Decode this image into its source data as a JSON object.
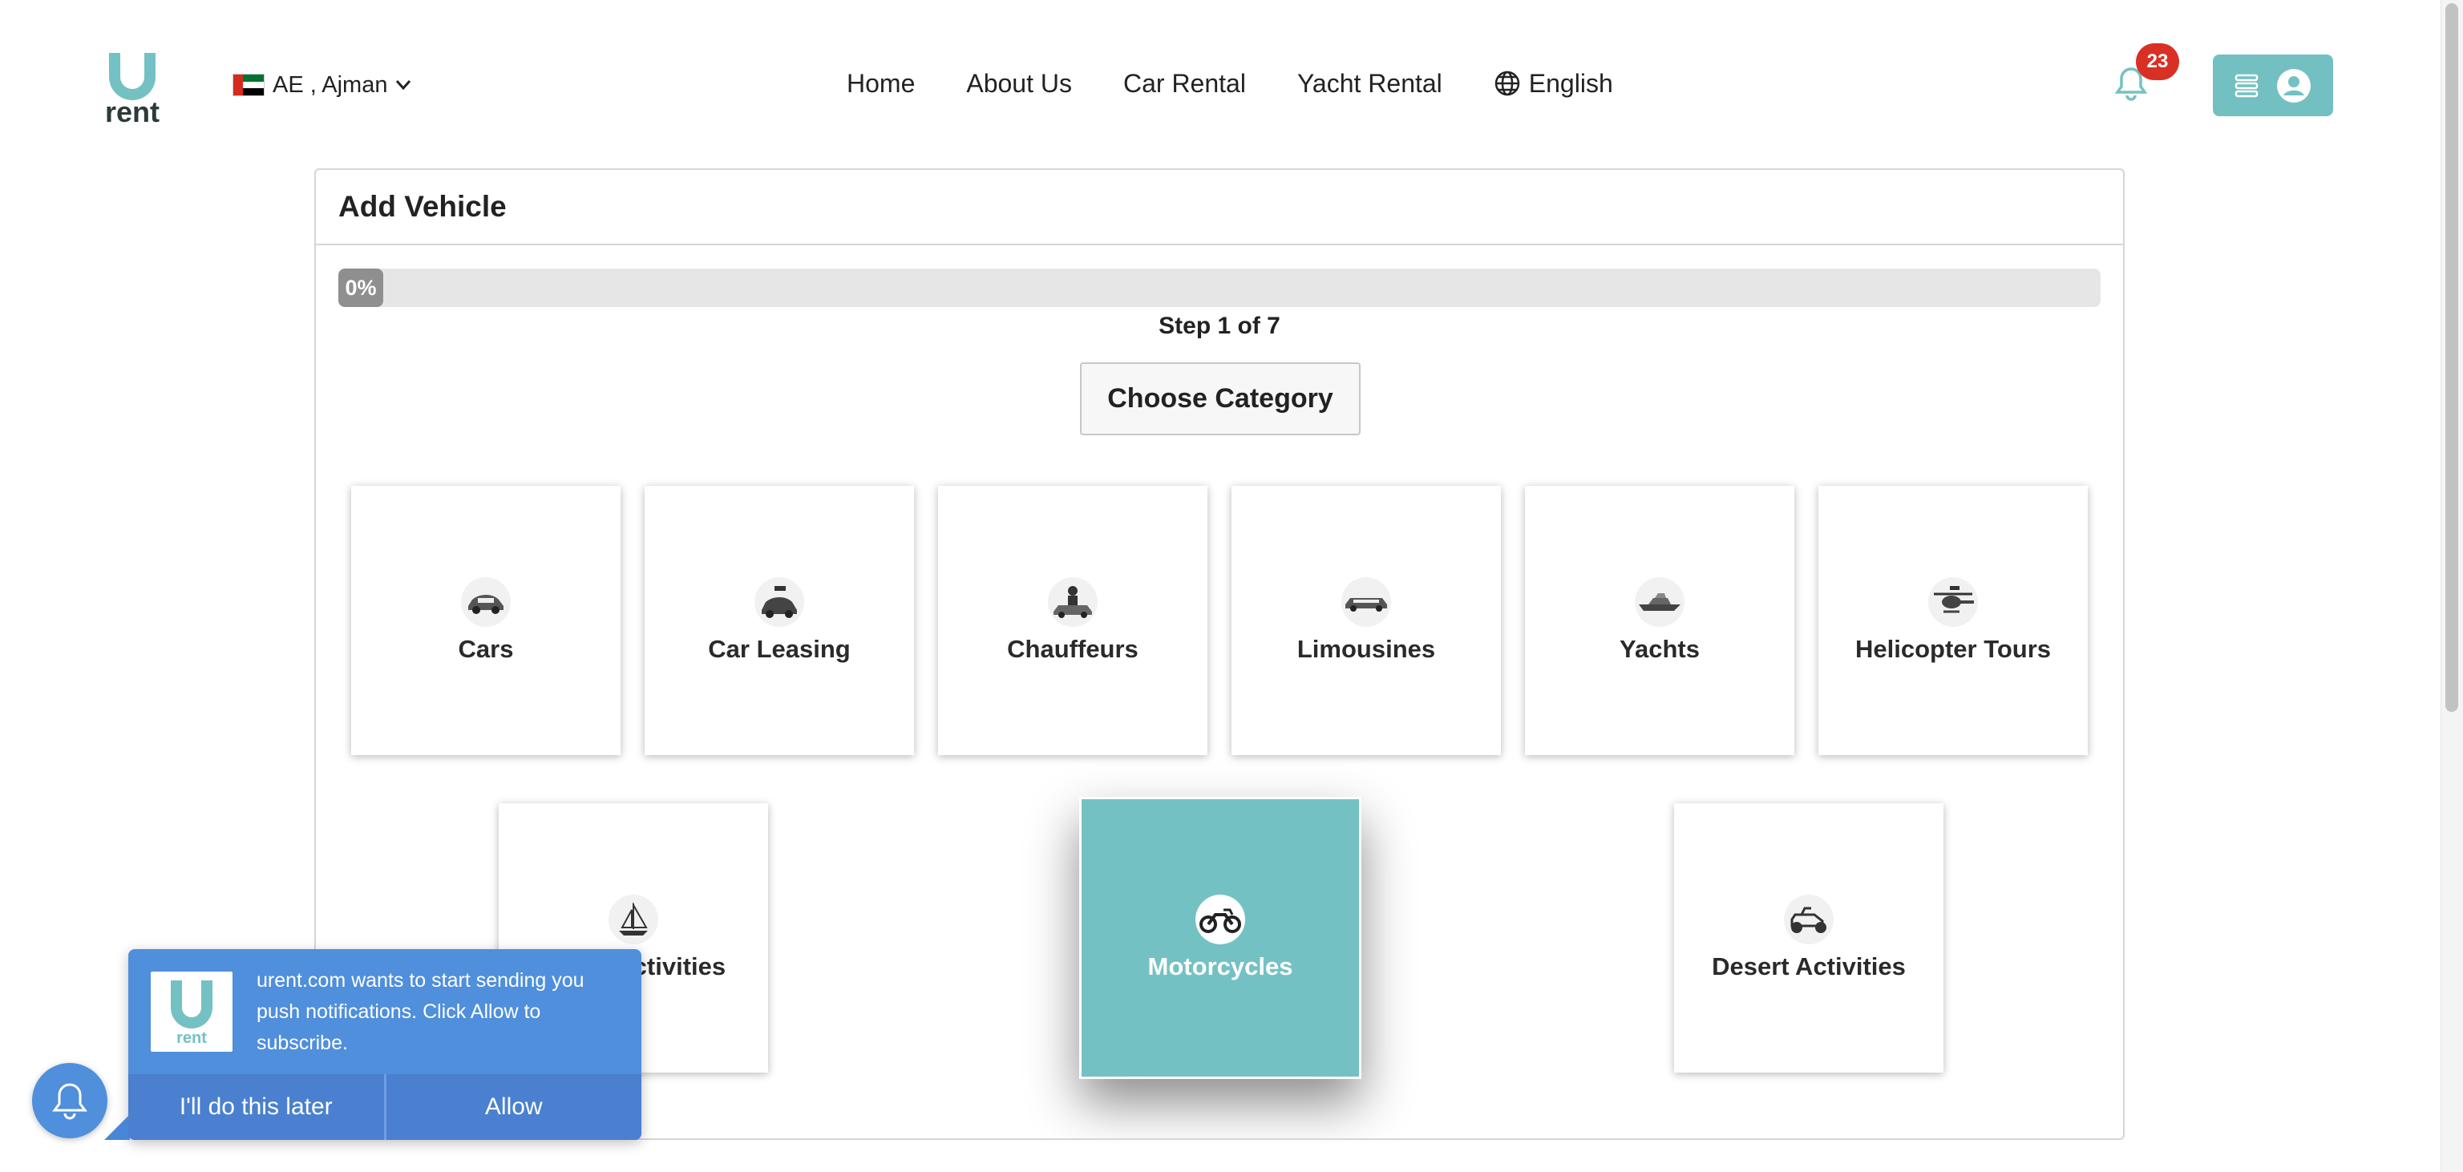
{
  "header": {
    "logo_text": "rent",
    "location": {
      "label": "AE , Ajman"
    },
    "nav": [
      {
        "label": "Home"
      },
      {
        "label": "About Us"
      },
      {
        "label": "Car Rental"
      },
      {
        "label": "Yacht Rental"
      }
    ],
    "language": {
      "label": "English"
    },
    "notifications": {
      "count": "23"
    }
  },
  "card": {
    "title": "Add Vehicle",
    "progress": {
      "label": "0%",
      "percent": 0
    },
    "step_text": "Step 1 of 7",
    "choose_button": "Choose Category",
    "categories": [
      {
        "label": "Cars",
        "icon": "car-icon"
      },
      {
        "label": "Car Leasing",
        "icon": "car-key-icon"
      },
      {
        "label": "Chauffeurs",
        "icon": "chauffeur-icon"
      },
      {
        "label": "Limousines",
        "icon": "limousine-icon"
      },
      {
        "label": "Yachts",
        "icon": "yacht-icon"
      },
      {
        "label": "Helicopter Tours",
        "icon": "helicopter-icon"
      },
      {
        "label": "Water Activities",
        "icon": "sailboat-icon"
      },
      {
        "label": "Motorcycles",
        "icon": "motorcycle-icon",
        "selected": true
      },
      {
        "label": "Desert Activities",
        "icon": "dune-buggy-icon"
      }
    ]
  },
  "push_prompt": {
    "message": "urent.com wants to start sending you push notifications. Click Allow to subscribe.",
    "later_label": "I'll do this later",
    "allow_label": "Allow"
  },
  "colors": {
    "brand_teal": "#74c1c3",
    "badge_red": "#d93025",
    "push_blue": "#4f8fdc"
  }
}
